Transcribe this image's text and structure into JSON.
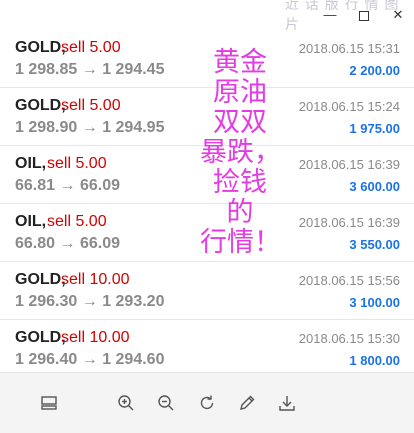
{
  "window": {
    "title_watermark": "近 话 版 行 情 图 片",
    "minimize_glyph": "—",
    "close_glyph": "✕"
  },
  "trades": [
    {
      "symbol": "GOLD,",
      "side": "sell 5.00",
      "open": "1 298.85",
      "arrow": "→",
      "close": "1 294.45",
      "time": "2018.06.15 15:31",
      "profit": "2 200.00"
    },
    {
      "symbol": "GOLD,",
      "side": "sell 5.00",
      "open": "1 298.90",
      "arrow": "→",
      "close": "1 294.95",
      "time": "2018.06.15 15:24",
      "profit": "1 975.00"
    },
    {
      "symbol": "OIL,",
      "side": "sell 5.00",
      "open": "66.81",
      "arrow": "→",
      "close": "66.09",
      "time": "2018.06.15 16:39",
      "profit": "3 600.00"
    },
    {
      "symbol": "OIL,",
      "side": "sell 5.00",
      "open": "66.80",
      "arrow": "→",
      "close": "66.09",
      "time": "2018.06.15 16:39",
      "profit": "3 550.00"
    },
    {
      "symbol": "GOLD,",
      "side": "sell 10.00",
      "open": "1 296.30",
      "arrow": "→",
      "close": "1 293.20",
      "time": "2018.06.15 15:56",
      "profit": "3 100.00"
    },
    {
      "symbol": "GOLD,",
      "side": "sell 10.00",
      "open": "1 296.40",
      "arrow": "→",
      "close": "1 294.60",
      "time": "2018.06.15 15:30",
      "profit": "1 800.00"
    }
  ],
  "overlay_text": {
    "line1": "黄金",
    "line2": "原油",
    "line3": "双双",
    "line4": "暴跌，",
    "line5": "捡钱",
    "line6": "的",
    "line7": "行情！"
  },
  "toolbar": {
    "icons": [
      "layout-icon",
      "zoom-in-icon",
      "zoom-out-icon",
      "rotate-icon",
      "edit-icon",
      "download-icon"
    ]
  },
  "colors": {
    "sell": "#d50000",
    "profit": "#1a73e8",
    "overlay": "#e23ce2",
    "muted": "#8a8a8a"
  }
}
